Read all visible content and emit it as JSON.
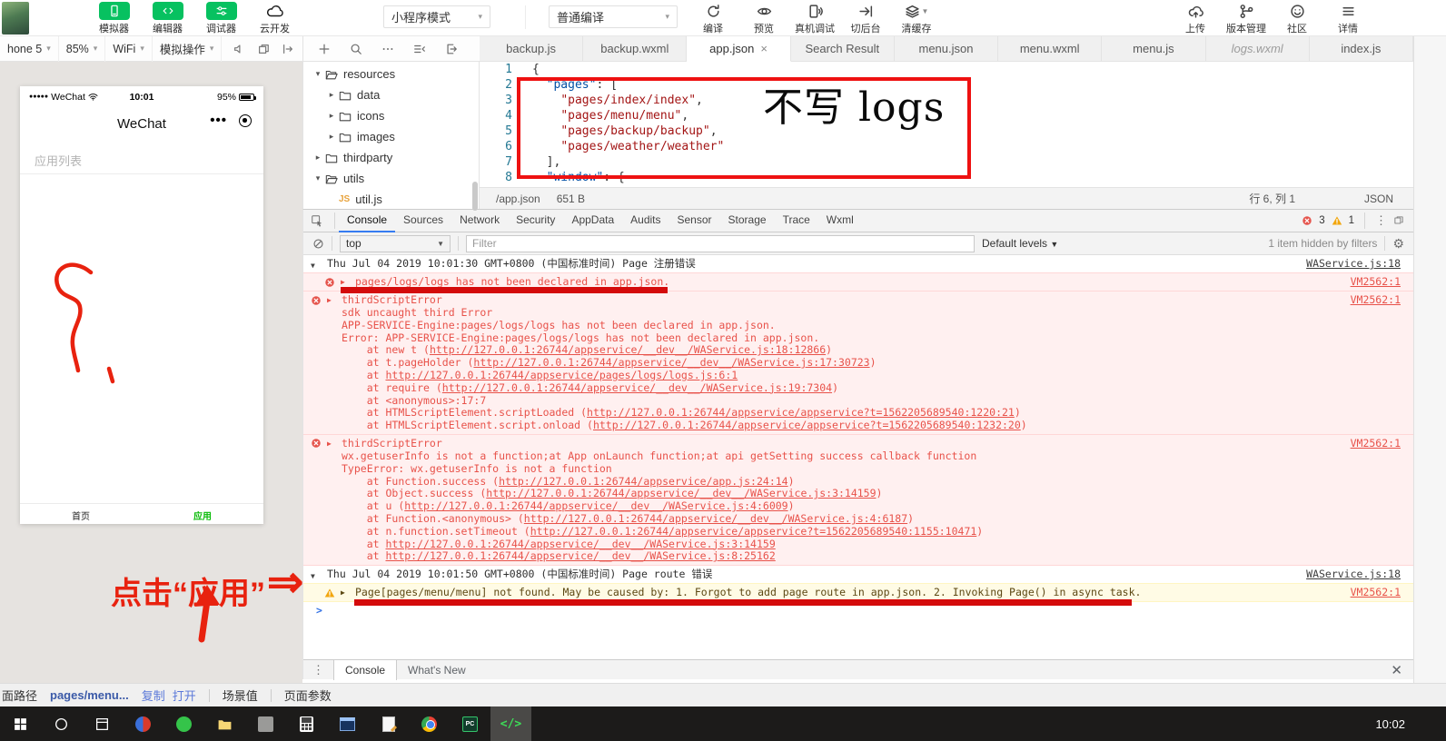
{
  "top_toolbar": {
    "main_buttons": [
      {
        "name": "simulator",
        "label": "模拟器",
        "icon": "phone"
      },
      {
        "name": "editor",
        "label": "编辑器",
        "icon": "code"
      },
      {
        "name": "debugger",
        "label": "调试器",
        "icon": "sliders"
      },
      {
        "name": "cloud-dev",
        "label": "云开发",
        "icon": "cloud",
        "plain": true
      }
    ],
    "mode_dropdown": "小程序模式",
    "compile_dropdown": "普通编译",
    "actions": [
      {
        "name": "compile",
        "label": "编译",
        "icon": "refresh"
      },
      {
        "name": "preview",
        "label": "预览",
        "icon": "eye"
      },
      {
        "name": "remote-debug",
        "label": "真机调试",
        "icon": "phoneDebug"
      },
      {
        "name": "switch-background",
        "label": "切后台",
        "icon": "toBack"
      },
      {
        "name": "clear-cache",
        "label": "清缓存",
        "icon": "layers",
        "caret": true
      }
    ],
    "right_actions": [
      {
        "name": "upload",
        "label": "上传",
        "icon": "cloudUp"
      },
      {
        "name": "version-control",
        "label": "版本管理",
        "icon": "branch"
      },
      {
        "name": "community",
        "label": "社区",
        "icon": "smile"
      },
      {
        "name": "details",
        "label": "详情",
        "icon": "burger"
      }
    ]
  },
  "sim_bar": {
    "device": "hone 5",
    "zoom": "85%",
    "network": "WiFi",
    "actions_label": "模拟操作"
  },
  "phone": {
    "signal_dots": "●●●●●",
    "carrier": "WeChat",
    "time": "10:01",
    "battery": "95%",
    "nav_title": "WeChat",
    "menu_dots": "•••",
    "list_label": "应用列表",
    "tab_home": "首页",
    "tab_app": "应用"
  },
  "file_tree": {
    "items": [
      {
        "label": "resources",
        "depth": 0,
        "open": true
      },
      {
        "label": "data",
        "depth": 1,
        "open": false
      },
      {
        "label": "icons",
        "depth": 1,
        "open": false
      },
      {
        "label": "images",
        "depth": 1,
        "open": false
      },
      {
        "label": "thirdparty",
        "depth": 0,
        "open": false
      },
      {
        "label": "utils",
        "depth": 0,
        "open": true
      },
      {
        "label": "util.js",
        "depth": 1,
        "file": "js"
      }
    ]
  },
  "editor": {
    "tabs": [
      {
        "label": "backup.js"
      },
      {
        "label": "backup.wxml"
      },
      {
        "label": "app.json",
        "active": true,
        "close": true
      },
      {
        "label": "Search Result"
      },
      {
        "label": "menu.json"
      },
      {
        "label": "menu.wxml"
      },
      {
        "label": "menu.js"
      },
      {
        "label": "logs.wxml",
        "italic": true
      },
      {
        "label": "index.js"
      }
    ],
    "lines": [
      {
        "num": "1",
        "tokens": [
          {
            "t": "{",
            "c": "pun"
          }
        ]
      },
      {
        "num": "2",
        "tokens": [
          {
            "t": "  ",
            "c": "pun"
          },
          {
            "t": "\"pages\"",
            "c": "key"
          },
          {
            "t": ": [",
            "c": "pun"
          }
        ]
      },
      {
        "num": "3",
        "tokens": [
          {
            "t": "    ",
            "c": "pun"
          },
          {
            "t": "\"pages/index/index\"",
            "c": "str"
          },
          {
            "t": ",",
            "c": "pun"
          }
        ]
      },
      {
        "num": "4",
        "tokens": [
          {
            "t": "    ",
            "c": "pun"
          },
          {
            "t": "\"pages/menu/menu\"",
            "c": "str"
          },
          {
            "t": ",",
            "c": "pun"
          }
        ]
      },
      {
        "num": "5",
        "tokens": [
          {
            "t": "    ",
            "c": "pun"
          },
          {
            "t": "\"pages/backup/backup\"",
            "c": "str"
          },
          {
            "t": ",",
            "c": "pun"
          }
        ]
      },
      {
        "num": "6",
        "tokens": [
          {
            "t": "    ",
            "c": "pun"
          },
          {
            "t": "\"pages/weather/weather\"",
            "c": "str"
          }
        ]
      },
      {
        "num": "7",
        "tokens": [
          {
            "t": "  ],",
            "c": "pun"
          }
        ]
      },
      {
        "num": "8",
        "tokens": [
          {
            "t": "  ",
            "c": "pun"
          },
          {
            "t": "\"window\"",
            "c": "key"
          },
          {
            "t": ": {",
            "c": "pun"
          }
        ]
      }
    ],
    "status": {
      "path": "/app.json",
      "size": "651 B",
      "cursor": "行 6, 列 1",
      "lang": "JSON"
    }
  },
  "devtools": {
    "tabs": [
      "Console",
      "Sources",
      "Network",
      "Security",
      "AppData",
      "Audits",
      "Sensor",
      "Storage",
      "Trace",
      "Wxml"
    ],
    "active_tab": "Console",
    "error_count": "3",
    "warning_count": "1",
    "context": "top",
    "filter_placeholder": "Filter",
    "levels": "Default levels",
    "hidden_note": "1 item hidden by filters",
    "console": [
      {
        "type": "group",
        "text": "Thu Jul 04 2019 10:01:30 GMT+0800 (中国标准时间) Page 注册错误",
        "meta": "WAService.js:18"
      },
      {
        "type": "error",
        "indent": true,
        "text": "pages/logs/logs has not been declared in app.json.",
        "meta": "VM2562:1"
      },
      {
        "type": "error",
        "text": "thirdScriptError",
        "meta": "VM2562:1",
        "lines": [
          "sdk uncaught third Error",
          "APP-SERVICE-Engine:pages/logs/logs has not been declared in app.json.",
          "Error: APP-SERVICE-Engine:pages/logs/logs has not been declared in app.json.",
          "    at new t (http://127.0.0.1:26744/appservice/__dev__/WAService.js:18:12866)",
          "    at t.pageHolder (http://127.0.0.1:26744/appservice/__dev__/WAService.js:17:30723)",
          "    at http://127.0.0.1:26744/appservice/pages/logs/logs.js:6:1",
          "    at require (http://127.0.0.1:26744/appservice/__dev__/WAService.js:19:7304)",
          "    at <anonymous>:17:7",
          "    at HTMLScriptElement.scriptLoaded (http://127.0.0.1:26744/appservice/appservice?t=1562205689540:1220:21)",
          "    at HTMLScriptElement.script.onload (http://127.0.0.1:26744/appservice/appservice?t=1562205689540:1232:20)"
        ]
      },
      {
        "type": "error",
        "text": "thirdScriptError",
        "meta": "VM2562:1",
        "lines": [
          "wx.getuserInfo is not a function;at App onLaunch function;at api getSetting success callback function",
          "TypeError: wx.getuserInfo is not a function",
          "    at Function.success (http://127.0.0.1:26744/appservice/app.js:24:14)",
          "    at Object.success (http://127.0.0.1:26744/appservice/__dev__/WAService.js:3:14159)",
          "    at u (http://127.0.0.1:26744/appservice/__dev__/WAService.js:4:6009)",
          "    at Function.<anonymous> (http://127.0.0.1:26744/appservice/__dev__/WAService.js:4:6187)",
          "    at n.function.setTimeout (http://127.0.0.1:26744/appservice/appservice?t=1562205689540:1155:10471)",
          "    at http://127.0.0.1:26744/appservice/__dev__/WAService.js:3:14159",
          "    at http://127.0.0.1:26744/appservice/__dev__/WAService.js:8:25162"
        ]
      },
      {
        "type": "group",
        "text": "Thu Jul 04 2019 10:01:50 GMT+0800 (中国标准时间) Page route 错误",
        "meta": "WAService.js:18"
      },
      {
        "type": "warning",
        "indent": true,
        "text": "Page[pages/menu/menu] not found. May be caused by: 1. Forgot to add page route in app.json. 2. Invoking Page() in async task.",
        "meta": "VM2562:1"
      },
      {
        "type": "prompt"
      }
    ],
    "drawer_tabs": [
      "Console",
      "What's New"
    ]
  },
  "bottom_bar": {
    "path_label": "面路径",
    "path_value": "pages/menu...",
    "copy": "复制",
    "open": "打开",
    "scene_label": "场景值",
    "params_label": "页面参数"
  },
  "annotations": {
    "no_logs": "不写 logs",
    "click_app": "点击“应用”",
    "arrow": "⇒"
  },
  "taskbar": {
    "time": "10:02",
    "icons": [
      "start",
      "search",
      "task-view",
      "browser-360",
      "thunder",
      "file-explorer",
      "archive",
      "calculator",
      "sql-terminal",
      "notes",
      "chrome",
      "pc-manager",
      "wechat-devtools"
    ],
    "active_icon": "wechat-devtools"
  }
}
